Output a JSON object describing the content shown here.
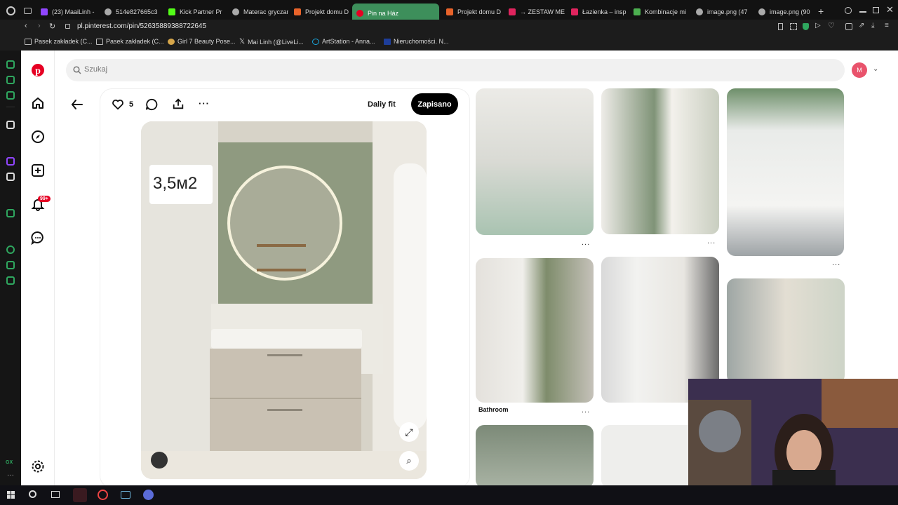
{
  "browser": {
    "tabs": [
      {
        "title": "(23) MaaiLinh -",
        "fav_color": "#9146ff"
      },
      {
        "title": "514e827665c3",
        "fav_color": "#cccccc"
      },
      {
        "title": "Kick Partner Pr",
        "fav_color": "#53fc18"
      },
      {
        "title": "Materac gryczan",
        "fav_color": "#cccccc"
      },
      {
        "title": "Projekt domu D",
        "fav_color": "#e8632a"
      },
      {
        "title": "Pin na Ház",
        "fav_color": "#e60023"
      },
      {
        "title": "Projekt domu D",
        "fav_color": "#e8632a"
      },
      {
        "title": "→ ZESTAW ME",
        "fav_color": "#e0245e"
      },
      {
        "title": "Łazienka – insp",
        "fav_color": "#e0245e"
      },
      {
        "title": "Kombinacje mi",
        "fav_color": "#4caf50"
      },
      {
        "title": "image.png (47",
        "fav_color": "#cccccc"
      },
      {
        "title": "image.png (90",
        "fav_color": "#cccccc"
      }
    ],
    "url": "pl.pinterest.com/pin/52635889388722645",
    "bookmarks": [
      {
        "label": "Pasek zakładek (C..."
      },
      {
        "label": "Pasek zakładek (C..."
      },
      {
        "label": "Girl 7 Beauty Pose..."
      },
      {
        "label": "Mai Linh (@LiveLi..."
      },
      {
        "label": "ArtStation - Anna..."
      },
      {
        "label": "Nieruchomości. N..."
      }
    ]
  },
  "pinterest": {
    "search_placeholder": "Szukaj",
    "avatar_letter": "M",
    "notification_count": "99+",
    "pin": {
      "likes": "5",
      "board_name": "Daliy fit",
      "saved_label": "Zapisano",
      "image_text": "3,5м2"
    },
    "grid_caption": "Bathroom",
    "more_dots": "..."
  },
  "colors": {
    "pinterest_red": "#e60023",
    "active_tab": "#3d8f5b",
    "opera_green": "#2fa75f"
  }
}
